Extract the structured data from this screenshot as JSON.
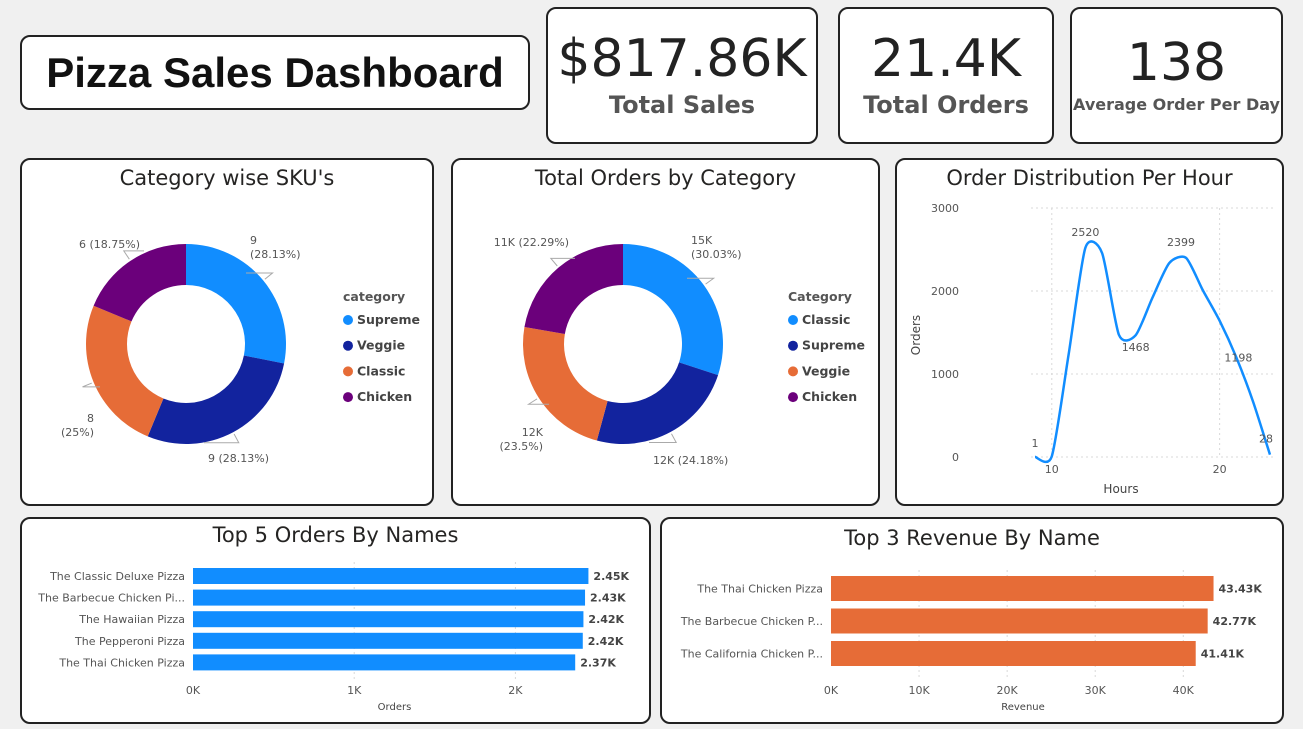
{
  "title": "Pizza Sales Dashboard",
  "kpis": {
    "total_sales": {
      "value": "$817.86K",
      "label": "Total Sales"
    },
    "total_orders": {
      "value": "21.4K",
      "label": "Total Orders"
    },
    "avg_orders": {
      "value": "138",
      "label": "Average Order Per Day"
    }
  },
  "colors": {
    "blue": "#118DFF",
    "navy": "#12239E",
    "orange": "#E66C37",
    "purple": "#6B007B"
  },
  "chart_data": [
    {
      "type": "pie",
      "title": "Category wise SKU's",
      "legend_title": "category",
      "legend_position": "right",
      "categories": [
        "Supreme",
        "Veggie",
        "Classic",
        "Chicken"
      ],
      "values": [
        9,
        9,
        8,
        6
      ],
      "labels": [
        [
          "9",
          "(28.13%)"
        ],
        [
          "9 (28.13%)"
        ],
        [
          "8",
          "(25%)"
        ],
        [
          "6 (18.75%)"
        ]
      ],
      "colors": [
        "#118DFF",
        "#12239E",
        "#E66C37",
        "#6B007B"
      ]
    },
    {
      "type": "pie",
      "title": "Total Orders by Category",
      "legend_title": "Category",
      "legend_position": "right",
      "categories": [
        "Classic",
        "Supreme",
        "Veggie",
        "Chicken"
      ],
      "values": [
        15000,
        12000,
        12000,
        11000
      ],
      "percent": [
        30.03,
        24.18,
        23.5,
        22.29
      ],
      "labels": [
        [
          "15K",
          "(30.03%)"
        ],
        [
          "12K (24.18%)"
        ],
        [
          "12K",
          "(23.5%)"
        ],
        [
          "11K (22.29%)"
        ]
      ],
      "colors": [
        "#118DFF",
        "#12239E",
        "#E66C37",
        "#6B007B"
      ]
    },
    {
      "type": "line",
      "title": "Order Distribution Per Hour",
      "xlabel": "Hours",
      "ylabel": "Orders",
      "x": [
        9,
        10,
        11,
        12,
        13,
        14,
        15,
        16,
        17,
        18,
        19,
        20,
        21,
        22,
        23
      ],
      "y": [
        1,
        8,
        1231,
        2520,
        2455,
        1472,
        1468,
        1920,
        2336,
        2399,
        2009,
        1642,
        1198,
        663,
        28
      ],
      "xticks": [
        10,
        20
      ],
      "yticks": [
        0,
        1000,
        2000,
        3000
      ],
      "ylim": [
        0,
        3000
      ],
      "point_labels": [
        {
          "x": 9,
          "y": 1,
          "text": "1"
        },
        {
          "x": 12,
          "y": 2520,
          "text": "2520"
        },
        {
          "x": 15,
          "y": 1468,
          "text": "1468"
        },
        {
          "x": 18,
          "y": 2399,
          "text": "2399"
        },
        {
          "x": 21,
          "y": 1198,
          "text": "1198"
        },
        {
          "x": 23,
          "y": 28,
          "text": "28"
        }
      ],
      "color": "#118DFF"
    },
    {
      "type": "bar",
      "title": "Top 5 Orders By Names",
      "xlabel": "Orders",
      "categories": [
        "The Classic Deluxe Pizza",
        "The Barbecue Chicken Pi...",
        "The Hawaiian Pizza",
        "The Pepperoni Pizza",
        "The Thai Chicken Pizza"
      ],
      "values": [
        2453,
        2432,
        2422,
        2418,
        2371
      ],
      "data_labels": [
        "2.45K",
        "2.43K",
        "2.42K",
        "2.42K",
        "2.37K"
      ],
      "xticks": [
        "0K",
        "1K",
        "2K"
      ],
      "tick_values": [
        0,
        1000,
        2000
      ],
      "xlim": [
        0,
        2500
      ],
      "color": "#118DFF"
    },
    {
      "type": "bar",
      "title": "Top 3 Revenue By Name",
      "xlabel": "Revenue",
      "categories": [
        "The Thai Chicken Pizza",
        "The Barbecue Chicken P...",
        "The California Chicken P..."
      ],
      "values": [
        43434,
        42768,
        41410
      ],
      "data_labels": [
        "43.43K",
        "42.77K",
        "41.41K"
      ],
      "xticks": [
        "0K",
        "10K",
        "20K",
        "30K",
        "40K"
      ],
      "tick_values": [
        0,
        10000,
        20000,
        30000,
        40000
      ],
      "xlim": [
        0,
        43600
      ],
      "color": "#E66C37"
    }
  ]
}
